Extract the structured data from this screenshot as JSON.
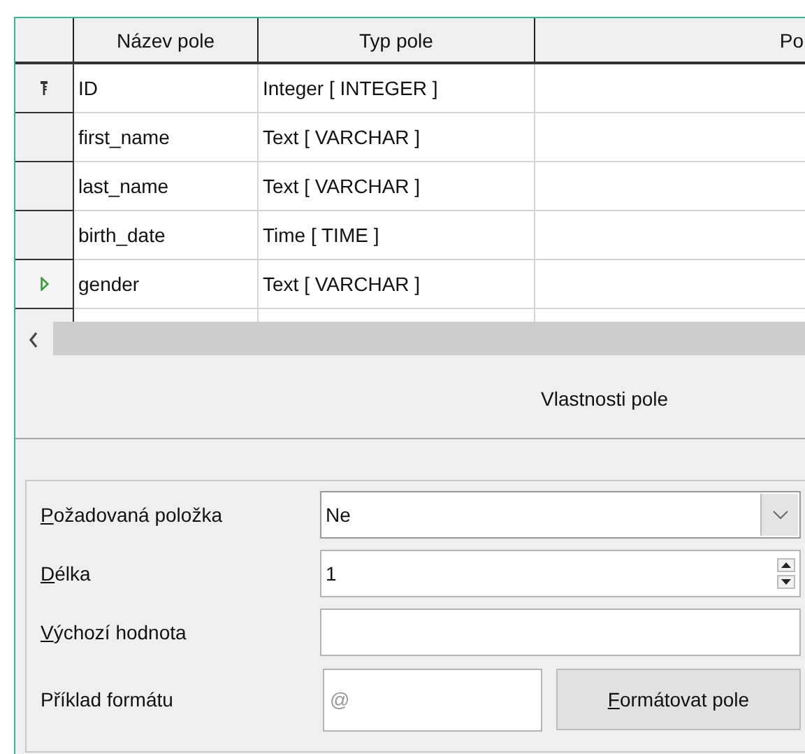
{
  "table": {
    "columns": [
      "Název pole",
      "Typ pole",
      "Po"
    ],
    "rows": [
      {
        "name": "ID",
        "type": "Integer [ INTEGER ]",
        "primary_key": true,
        "selected": false
      },
      {
        "name": "first_name",
        "type": "Text [ VARCHAR ]",
        "primary_key": false,
        "selected": false
      },
      {
        "name": "last_name",
        "type": "Text [ VARCHAR ]",
        "primary_key": false,
        "selected": false
      },
      {
        "name": "birth_date",
        "type": "Time [ TIME ]",
        "primary_key": false,
        "selected": false
      },
      {
        "name": "gender",
        "type": "Text [ VARCHAR ]",
        "primary_key": false,
        "selected": true
      }
    ]
  },
  "properties": {
    "title": "Vlastnosti pole",
    "fields": [
      {
        "kind": "dropdown",
        "label": "Požadovaná položka",
        "mnemonic": true,
        "value": "Ne"
      },
      {
        "kind": "spin",
        "label": "Délka",
        "mnemonic": true,
        "value": "1"
      },
      {
        "kind": "text",
        "label": "Výchozí hodnota",
        "mnemonic": true
      },
      {
        "kind": "format",
        "label": "Příklad formátu",
        "mnemonic": false,
        "value": "@",
        "button": {
          "label": "Formátovat pole",
          "mnemonic": true
        }
      }
    ]
  }
}
